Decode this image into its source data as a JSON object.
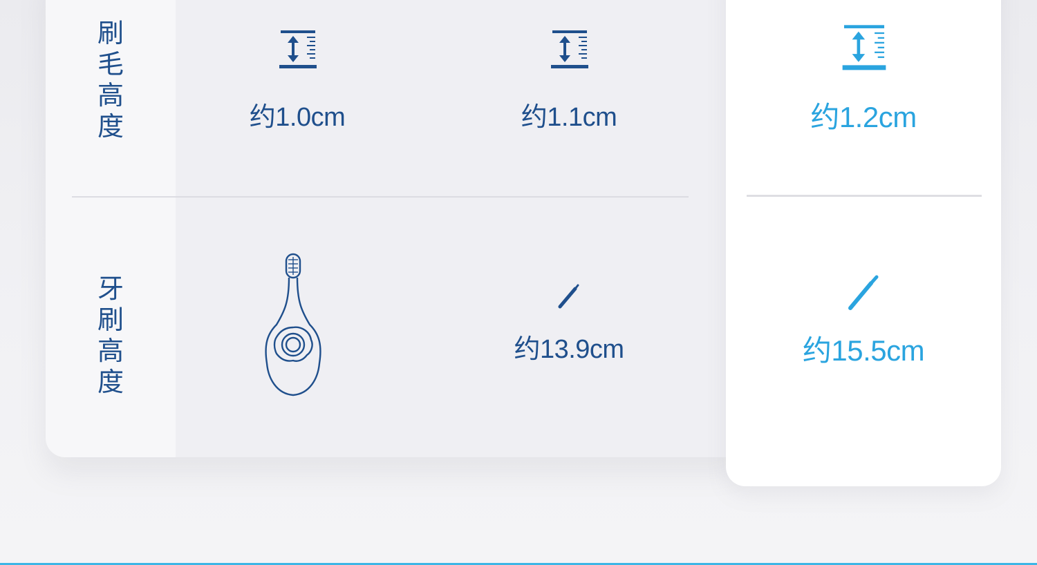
{
  "rows": [
    {
      "label": "刷毛高度",
      "values": [
        "约1.0cm",
        "约1.1cm",
        "约1.2cm"
      ],
      "icon": "height-measure-icon"
    },
    {
      "label": "牙刷高度",
      "values": [
        "",
        "约13.9cm",
        "约15.5cm"
      ],
      "icon": "toothbrush-icon"
    }
  ],
  "colors": {
    "text_dark_blue": "#1f4f8c",
    "text_highlight_blue": "#2aa4df",
    "card_bg": "#efeff3",
    "label_bg": "#f7f7f9",
    "highlight_bg": "#ffffff",
    "bottom_line": "#3cb6e6"
  }
}
